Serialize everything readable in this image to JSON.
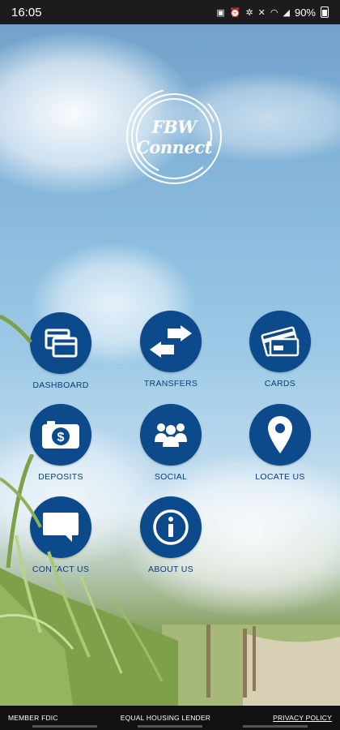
{
  "status_bar": {
    "time": "16:05",
    "battery": "90%"
  },
  "logo": {
    "text": "FBW Connect"
  },
  "tiles": [
    {
      "label": "DASHBOARD",
      "icon": "dashboard-icon"
    },
    {
      "label": "TRANSFERS",
      "icon": "transfer-arrows-icon"
    },
    {
      "label": "CARDS",
      "icon": "cards-icon"
    },
    {
      "label": "DEPOSITS",
      "icon": "camera-dollar-icon"
    },
    {
      "label": "SOCIAL",
      "icon": "people-icon"
    },
    {
      "label": "LOCATE US",
      "icon": "map-pin-icon"
    },
    {
      "label": "CONTACT US",
      "icon": "chat-bubble-icon"
    },
    {
      "label": "ABOUT US",
      "icon": "info-icon"
    }
  ],
  "footer": {
    "member_fdic": "MEMBER FDIC",
    "equal_housing": "EQUAL HOUSING LENDER",
    "privacy_policy": "PRIVACY POLICY"
  },
  "colors": {
    "accent": "#0c4a8c",
    "label": "#0c3d7a"
  }
}
